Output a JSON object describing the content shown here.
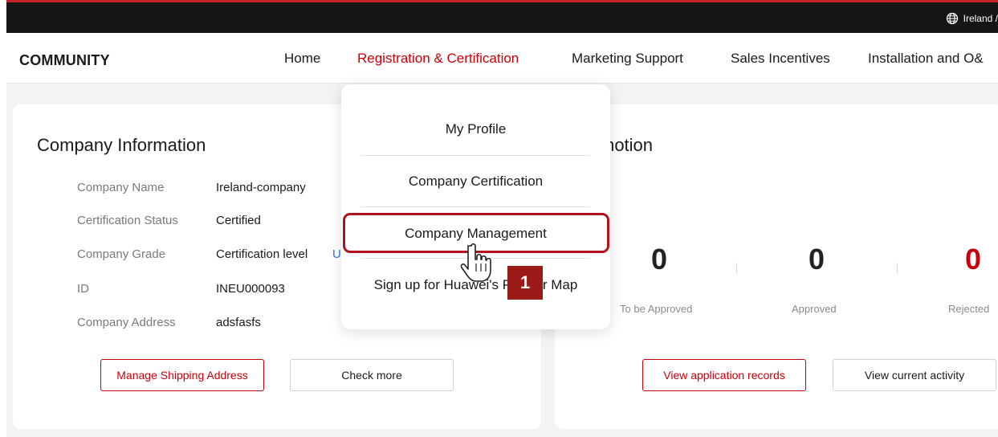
{
  "topbar": {
    "region": "Ireland /",
    "globe_icon": "globe-icon"
  },
  "nav": {
    "brand": "COMMUNITY",
    "items": [
      {
        "label": "Home"
      },
      {
        "label": "Registration & Certification",
        "active": true
      },
      {
        "label": "Marketing Support"
      },
      {
        "label": "Sales Incentives"
      },
      {
        "label": "Installation and O&"
      }
    ]
  },
  "dropdown": {
    "items": [
      {
        "label": "My Profile"
      },
      {
        "label": "Company Certification"
      },
      {
        "label": "Company Management",
        "highlighted": true
      },
      {
        "label": "Sign up for Huawei's Partner Map"
      }
    ],
    "step_badge": "1",
    "cursor_icon": "hand-pointer-icon"
  },
  "company_card": {
    "title": "Company Information",
    "fields": [
      {
        "label": "Company Name",
        "value": "Ireland-company"
      },
      {
        "label": "Certification Status",
        "value": "Certified"
      },
      {
        "label": "Company Grade",
        "value": "Certification level",
        "link": "U"
      },
      {
        "label": "ID",
        "value": "INEU000093"
      },
      {
        "label": "Company Address",
        "value": "adsfasfs"
      }
    ],
    "buttons": {
      "manage_shipping": "Manage Shipping Address",
      "check_more": "Check more"
    }
  },
  "promo_card": {
    "title_fragment": "motion",
    "stats": [
      {
        "value": "0",
        "label": "To be Approved",
        "color": "#1a1a1a"
      },
      {
        "value": "0",
        "label": "Approved",
        "color": "#1a1a1a"
      },
      {
        "value": "0",
        "label": "Rejected",
        "color": "#c7000b"
      }
    ],
    "buttons": {
      "view_records": "View application records",
      "view_activity": "View current activity"
    }
  },
  "colors": {
    "accent": "#c7000b",
    "topbar": "#151515",
    "badge": "#9c1a18",
    "link": "#2f77d0"
  }
}
